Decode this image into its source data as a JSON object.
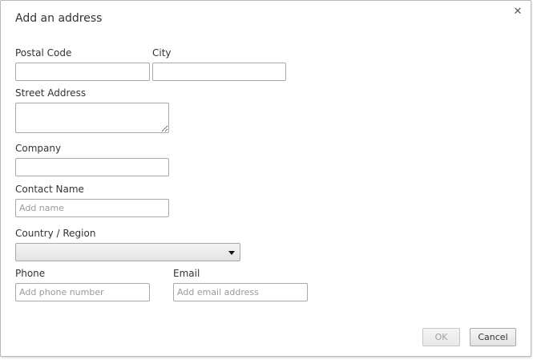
{
  "dialog": {
    "title": "Add an address",
    "close_icon": "close-icon"
  },
  "form": {
    "postal_code": {
      "label": "Postal Code",
      "value": "",
      "placeholder": ""
    },
    "city": {
      "label": "City",
      "value": "",
      "placeholder": ""
    },
    "street_address": {
      "label": "Street Address",
      "value": "",
      "placeholder": ""
    },
    "company": {
      "label": "Company",
      "value": "",
      "placeholder": ""
    },
    "contact_name": {
      "label": "Contact Name",
      "value": "",
      "placeholder": "Add name"
    },
    "country_region": {
      "label": "Country / Region",
      "selected": ""
    },
    "phone": {
      "label": "Phone",
      "value": "",
      "placeholder": "Add phone number"
    },
    "email": {
      "label": "Email",
      "value": "",
      "placeholder": "Add email address"
    }
  },
  "buttons": {
    "ok_label": "OK",
    "ok_enabled": false,
    "cancel_label": "Cancel"
  },
  "colors": {
    "border": "#a9a9a9",
    "text": "#333333",
    "placeholder": "#9a9a9a",
    "disabled_text": "#a0a0a0"
  }
}
